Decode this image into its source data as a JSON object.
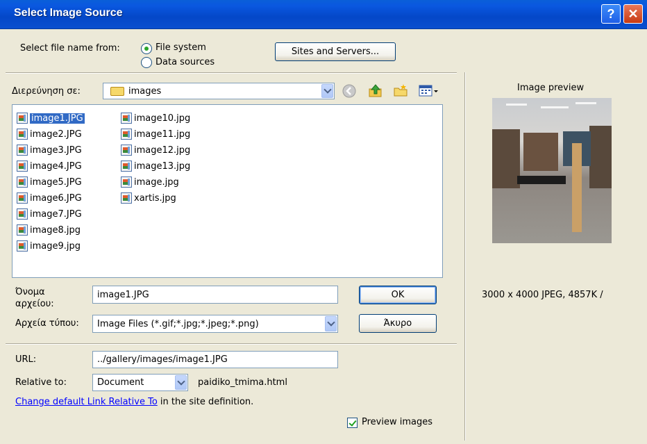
{
  "window": {
    "title": "Select Image Source",
    "help_label": "?",
    "close_label": "✕"
  },
  "source": {
    "label": "Select file name from:",
    "options": [
      {
        "label": "File system",
        "checked": true
      },
      {
        "label": "Data sources",
        "checked": false
      }
    ],
    "sites_button": "Sites and Servers..."
  },
  "browse": {
    "label": "Διερεύνηση σε:",
    "folder": "images",
    "toolbar_icons": [
      "back-icon",
      "up-folder-icon",
      "new-folder-icon",
      "view-menu-icon"
    ]
  },
  "files": {
    "column1": [
      "image1.JPG",
      "image2.JPG",
      "image3.JPG",
      "image4.JPG",
      "image5.JPG",
      "image6.JPG",
      "image7.JPG",
      "image8.jpg",
      "image9.jpg"
    ],
    "column2": [
      "image10.jpg",
      "image11.jpg",
      "image12.jpg",
      "image13.jpg",
      "image.jpg",
      "xartis.jpg"
    ],
    "selected": "image1.JPG"
  },
  "filename": {
    "label_line1": "Όνομα",
    "label_line2": "αρχείου:",
    "value": "image1.JPG"
  },
  "filetype": {
    "label": "Αρχεία τύπου:",
    "value": "Image Files (*.gif;*.jpg;*.jpeg;*.png)"
  },
  "buttons": {
    "ok": "OK",
    "cancel": "Άκυρο"
  },
  "url": {
    "label": "URL:",
    "value": "../gallery/images/image1.JPG"
  },
  "relative": {
    "label": "Relative to:",
    "value": "Document",
    "file": "paidiko_tmima.html"
  },
  "link": {
    "text": "Change default Link Relative To",
    "suffix": " in the site definition."
  },
  "preview": {
    "title": "Image preview",
    "info": "3000 x 4000 JPEG, 4857K /",
    "checkbox_label": "Preview images",
    "checkbox_checked": true
  }
}
